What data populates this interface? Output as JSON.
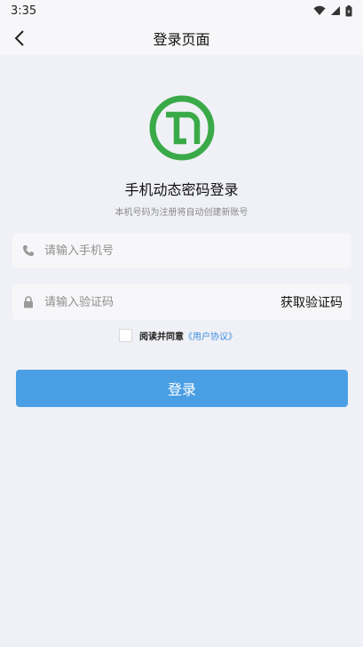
{
  "status_bar": {
    "time": "3:35",
    "icons": [
      "wifi-icon",
      "signal-icon",
      "battery-icon"
    ]
  },
  "nav": {
    "back_icon": "chevron-left-icon",
    "title": "登录页面"
  },
  "logo": {
    "icon": "app-logo",
    "color": "#3aaa48"
  },
  "main": {
    "heading": "手机动态密码登录",
    "subheading": "本机号码为注册将自动创建新账号"
  },
  "phone_field": {
    "icon": "phone-icon",
    "placeholder": "请输入手机号",
    "value": ""
  },
  "code_field": {
    "icon": "lock-icon",
    "placeholder": "请输入验证码",
    "value": "",
    "action_label": "获取验证码"
  },
  "agreement": {
    "checked": false,
    "text": "阅读并同意",
    "link": "《用户协议》"
  },
  "login_button": {
    "label": "登录",
    "color": "#4a9fe4"
  },
  "colors": {
    "background": "#f0f1f6",
    "link": "#3d8fe0"
  }
}
